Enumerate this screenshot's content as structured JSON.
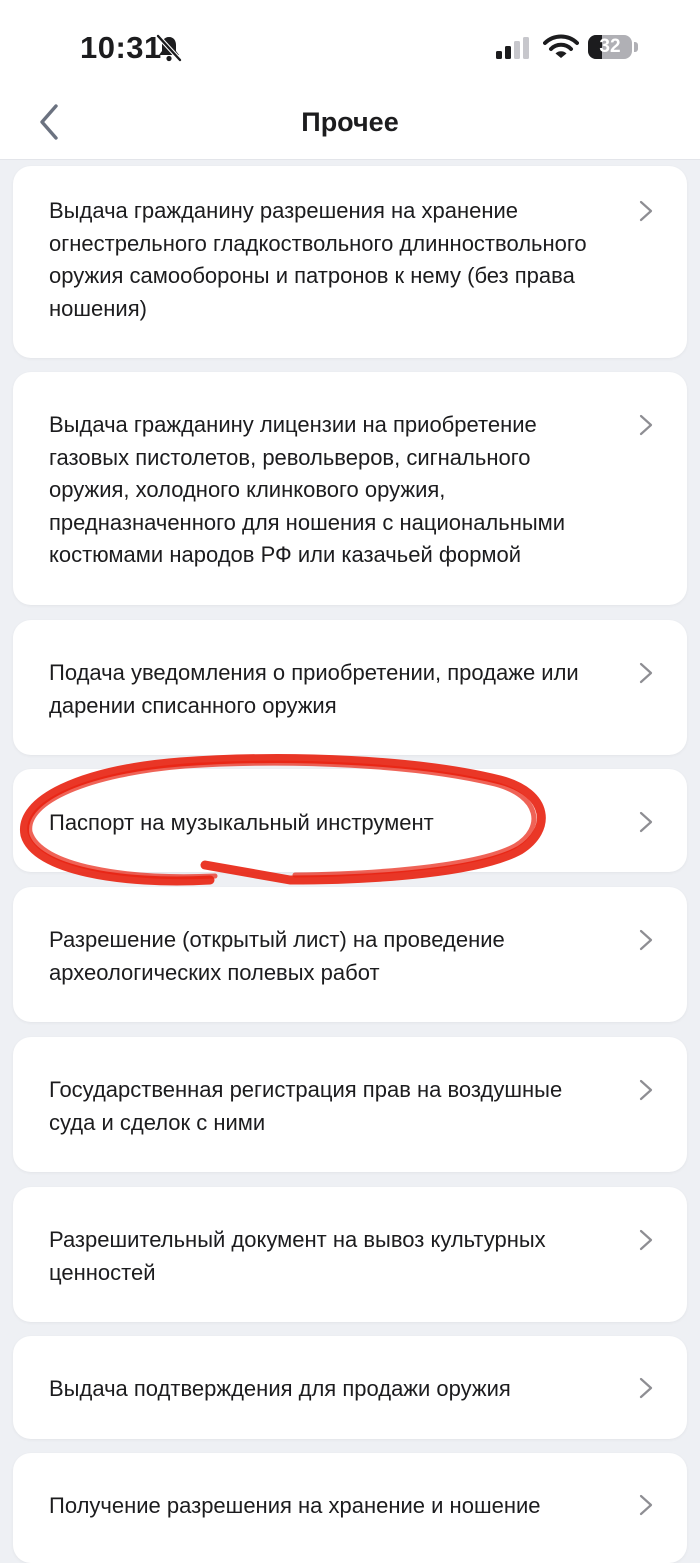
{
  "status_bar": {
    "time": "10:31",
    "battery": "32",
    "battery_level": 0.32
  },
  "header": {
    "title": "Прочее",
    "back_icon": "chevron-left-icon"
  },
  "items": [
    {
      "label": "Выдача гражданину разрешения на хранение огнестрельного гладкоствольного длинноствольного оружия самообороны и патронов к нему (без права ношения)"
    },
    {
      "label": "Выдача гражданину лицензии на приобретение газовых пистолетов, револьверов, сигнального оружия, холодного клинкового оружия, предназначенного для ношения с национальными костюмами народов РФ или казачьей формой"
    },
    {
      "label": "Подача уведомления о приобретении, продаже или дарении списанного оружия"
    },
    {
      "label": "Паспорт на музыкальный инструмент"
    },
    {
      "label": "Разрешение (открытый лист) на проведение археологических полевых работ"
    },
    {
      "label": "Государственная регистрация прав на воздушные суда и сделок с ними"
    },
    {
      "label": "Разрешительный документ на вывоз культурных ценностей"
    },
    {
      "label": "Выдача подтверждения для продажи оружия"
    },
    {
      "label": "Получение разрешения на хранение и ношение"
    }
  ],
  "colors": {
    "background": "#eef0f4",
    "card": "#ffffff",
    "text": "#1c1c1e",
    "chevron": "#8e8e93",
    "annotation": "#e8210f"
  },
  "icons": {
    "item_chevron": "chevron-right-icon",
    "silent": "bell-slash-icon",
    "signal": "cellular-signal-icon",
    "wifi": "wifi-icon"
  }
}
